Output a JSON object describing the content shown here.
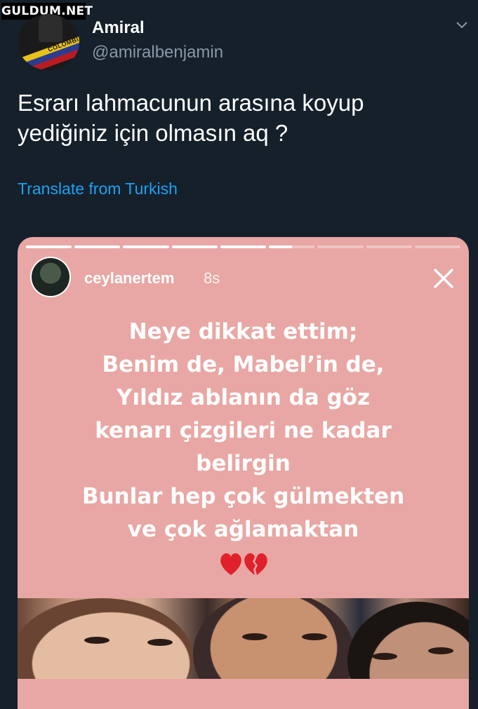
{
  "watermark": "GULDUM.NET",
  "tweet": {
    "author_name": "Amiral",
    "author_handle": "@amiralbenjamin",
    "text_lines": [
      "Esrarı lahmacunun arasına koyup",
      "yediğiniz için olmasın aq ?"
    ],
    "translate_label": "Translate from Turkish",
    "avatar_flag_text": "COLOMBIA"
  },
  "story": {
    "username": "ceylanertem",
    "time": "8s",
    "progress_segments": [
      1,
      1,
      1,
      1,
      1,
      0.5,
      0,
      0,
      0
    ],
    "lines": [
      "Neye dikkat ettim;",
      "Benim de, Mabel’in de,",
      "Yıldız ablanın da göz",
      "kenarı çizgileri ne kadar",
      "belirgin",
      "Bunlar hep çok gülmekten",
      "ve çok ağlamaktan"
    ],
    "emoji": [
      "red-heart",
      "broken-heart"
    ]
  },
  "colors": {
    "background": "#15202b",
    "link": "#1da1f2",
    "secondary_text": "#8899a6",
    "story_background": "#e8a7a4"
  }
}
